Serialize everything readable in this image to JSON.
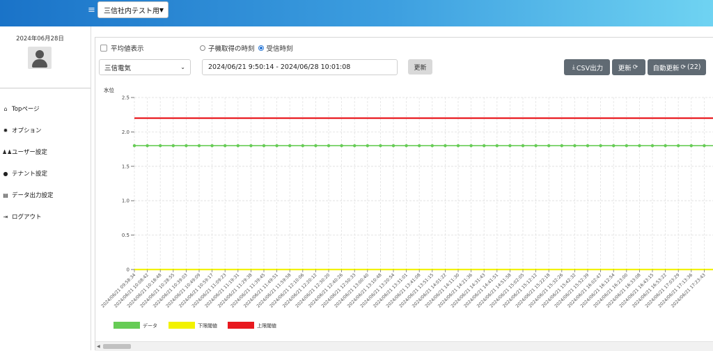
{
  "header": {
    "menu_icon": "hamburger-icon",
    "tenant_select": {
      "value": "三信社内テスト用"
    }
  },
  "sidebar": {
    "date": "2024年06月28日",
    "items": [
      {
        "label": "Topページ",
        "icon": "home-icon"
      },
      {
        "label": "オプション",
        "icon": "gear-icon"
      },
      {
        "label": "ユーザー設定",
        "icon": "users-icon"
      },
      {
        "label": "テナント設定",
        "icon": "map-pin-icon"
      },
      {
        "label": "データ出力設定",
        "icon": "file-export-icon"
      },
      {
        "label": "ログアウト",
        "icon": "logout-icon"
      }
    ]
  },
  "controls": {
    "average_label": "平均値表示",
    "time_mode": {
      "options": [
        {
          "label": "子機取得の時刻",
          "selected": false
        },
        {
          "label": "受信時刻",
          "selected": true
        }
      ]
    },
    "device_select_value": "三信電気",
    "range_value": "2024/06/21 9:50:14 - 2024/06/28 10:01:08",
    "apply_label": "更新",
    "csv_label": "CSV出力",
    "refresh_label": "更新",
    "auto_refresh_label": "自動更新",
    "auto_refresh_count": "(22)"
  },
  "chart_data": {
    "type": "line",
    "ylabel": "水位",
    "ylim": [
      0,
      2.5
    ],
    "yticks": [
      "0",
      "0.5",
      "1.0",
      "1.5",
      "2.0",
      "2.5"
    ],
    "grid": true,
    "x": [
      "2024/06/21 09:58:34",
      "2024/06/21 10:08:42",
      "2024/06/21 10:18:48",
      "2024/06/21 10:28:55",
      "2024/06/21 10:39:03",
      "2024/06/21 10:49:09",
      "2024/06/21 10:59:17",
      "2024/06/21 11:09:23",
      "2024/06/21 11:19:31",
      "2024/06/21 11:29:38",
      "2024/06/21 11:39:45",
      "2024/06/21 11:49:51",
      "2024/06/21 11:59:58",
      "2024/06/21 12:10:06",
      "2024/06/21 12:20:12",
      "2024/06/21 12:30:20",
      "2024/06/21 12:40:26",
      "2024/06/21 12:50:33",
      "2024/06/21 13:00:40",
      "2024/06/21 13:10:48",
      "2024/06/21 13:20:54",
      "2024/06/21 13:31:01",
      "2024/06/21 13:41:08",
      "2024/06/21 13:51:15",
      "2024/06/21 14:01:22",
      "2024/06/21 14:11:30",
      "2024/06/21 14:21:36",
      "2024/06/21 14:31:43",
      "2024/06/21 14:41:51",
      "2024/06/21 14:51:58",
      "2024/06/21 15:02:05",
      "2024/06/21 15:12:12",
      "2024/06/21 15:22:18",
      "2024/06/21 15:32:26",
      "2024/06/21 15:42:32",
      "2024/06/21 15:52:39",
      "2024/06/21 16:02:47",
      "2024/06/21 16:12:54",
      "2024/06/21 16:23:00",
      "2024/06/21 16:33:08",
      "2024/06/21 16:43:15",
      "2024/06/21 16:53:22",
      "2024/06/21 17:03:29",
      "2024/06/21 17:13:36",
      "2024/06/21 17:23:43",
      "2024/06/21 17:33"
    ],
    "series": [
      {
        "name": "データ",
        "color": "#66cc55",
        "values": [
          1.8,
          1.8,
          1.8,
          1.8,
          1.8,
          1.8,
          1.8,
          1.8,
          1.8,
          1.8,
          1.8,
          1.8,
          1.8,
          1.8,
          1.8,
          1.8,
          1.8,
          1.8,
          1.8,
          1.8,
          1.8,
          1.8,
          1.8,
          1.8,
          1.8,
          1.8,
          1.8,
          1.8,
          1.8,
          1.8,
          1.8,
          1.8,
          1.8,
          1.8,
          1.8,
          1.8,
          1.8,
          1.8,
          1.8,
          1.8,
          1.8,
          1.8,
          1.8,
          1.8,
          1.8,
          1.8
        ]
      },
      {
        "name": "下限閾値",
        "color": "#f2f200",
        "values": [
          0,
          0,
          0,
          0,
          0,
          0,
          0,
          0,
          0,
          0,
          0,
          0,
          0,
          0,
          0,
          0,
          0,
          0,
          0,
          0,
          0,
          0,
          0,
          0,
          0,
          0,
          0,
          0,
          0,
          0,
          0,
          0,
          0,
          0,
          0,
          0,
          0,
          0,
          0,
          0,
          0,
          0,
          0,
          0,
          0,
          0
        ]
      },
      {
        "name": "上限閾値",
        "color": "#e8191f",
        "values": [
          2.2,
          2.2,
          2.2,
          2.2,
          2.2,
          2.2,
          2.2,
          2.2,
          2.2,
          2.2,
          2.2,
          2.2,
          2.2,
          2.2,
          2.2,
          2.2,
          2.2,
          2.2,
          2.2,
          2.2,
          2.2,
          2.2,
          2.2,
          2.2,
          2.2,
          2.2,
          2.2,
          2.2,
          2.2,
          2.2,
          2.2,
          2.2,
          2.2,
          2.2,
          2.2,
          2.2,
          2.2,
          2.2,
          2.2,
          2.2,
          2.2,
          2.2,
          2.2,
          2.2,
          2.2,
          2.2
        ]
      }
    ],
    "legend_position": "bottom-left"
  }
}
